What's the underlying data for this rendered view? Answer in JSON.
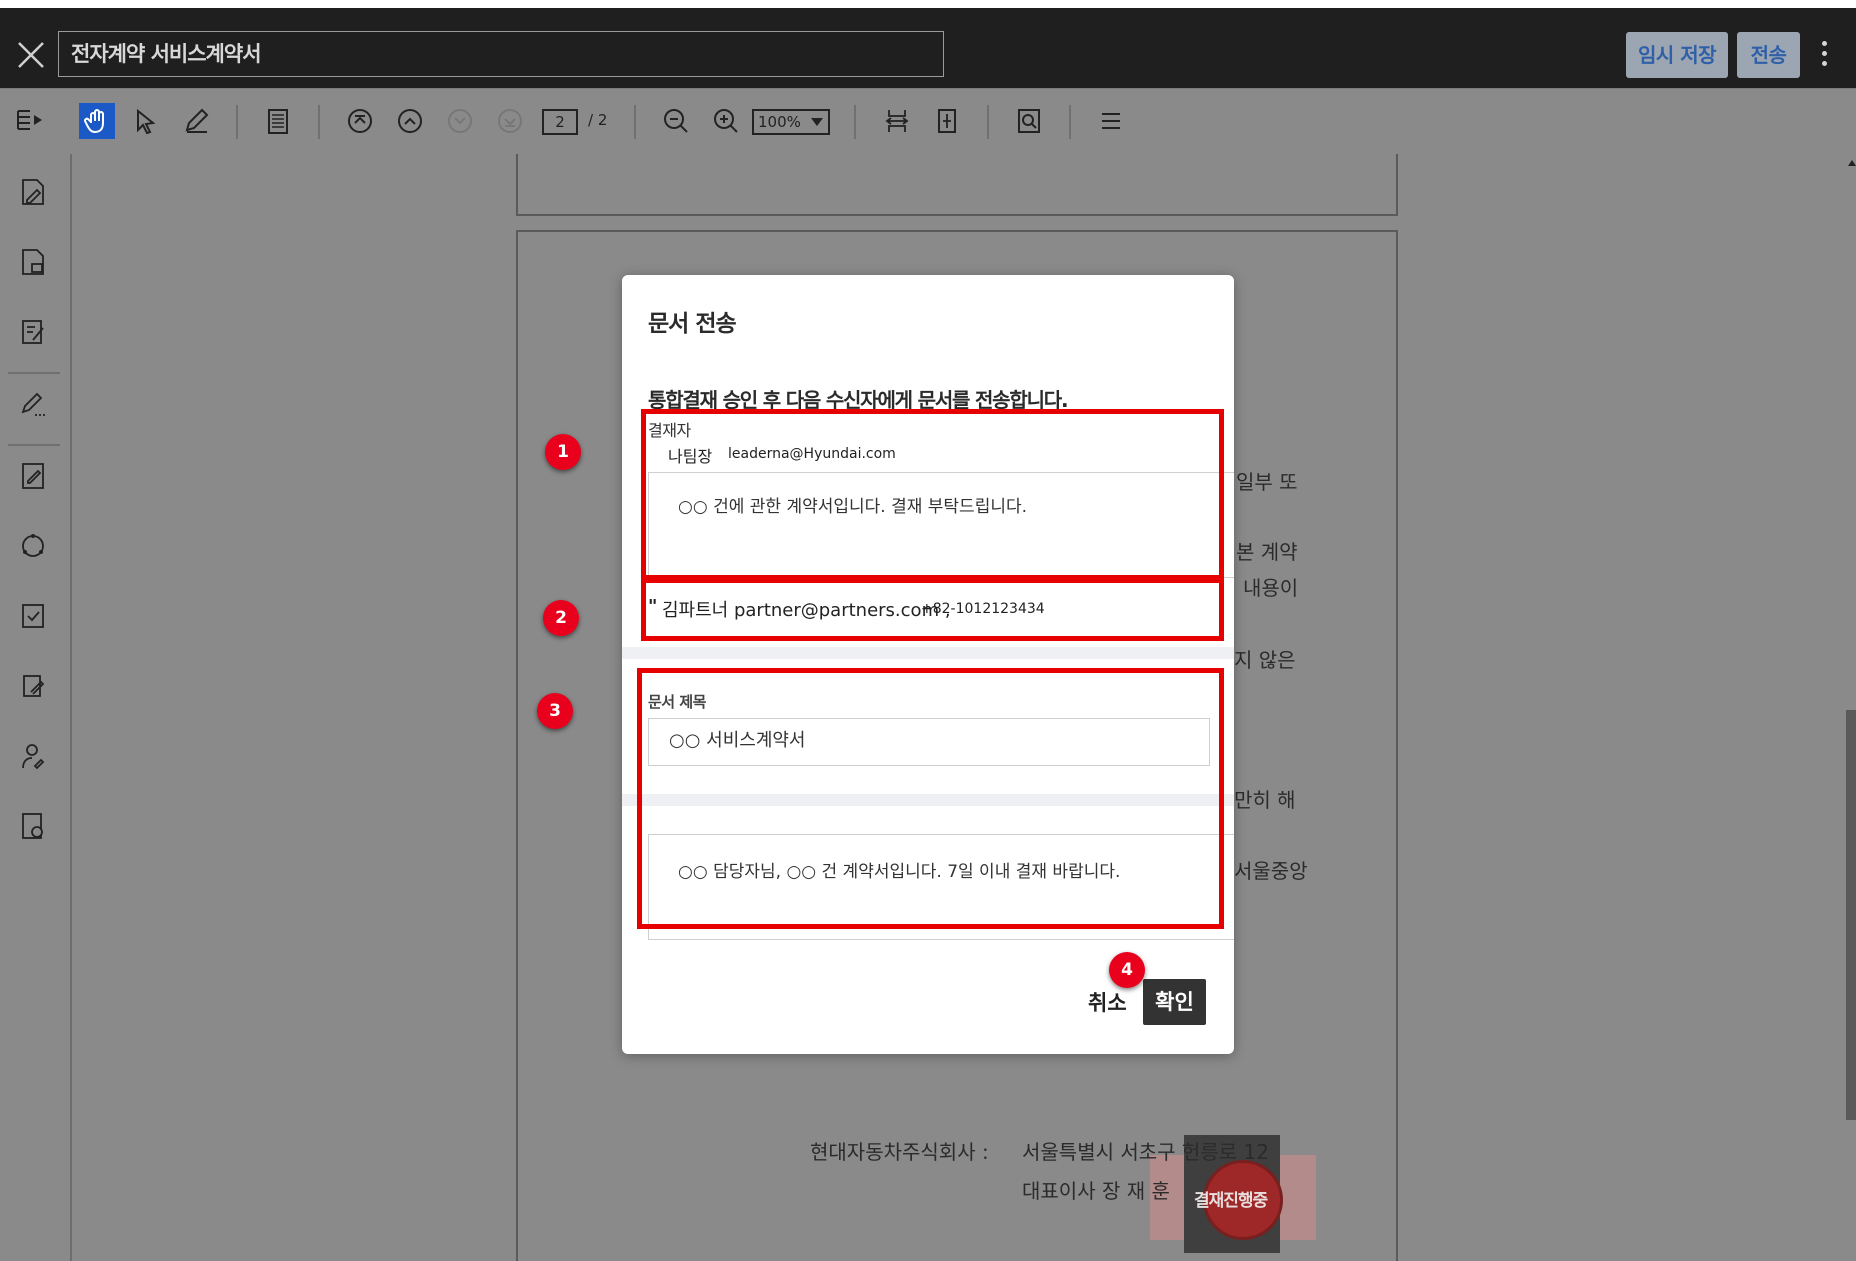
{
  "header": {
    "document_title": "전자계약 서비스계약서",
    "save_draft_label": "임시 저장",
    "send_label": "전송"
  },
  "toolbar": {
    "current_page": "2",
    "page_total": "/ 2",
    "zoom": "100%"
  },
  "document": {
    "lines": [
      "일부 또",
      "본 계약",
      "내용이",
      "지 않은",
      "만히 해",
      "서울중앙"
    ],
    "company": "현대자동차주식회사 :",
    "address": "서울특별시 서초구 헌릉로 12",
    "ceo": "대표이사  장 재 훈",
    "stamp_text": "결재진행중"
  },
  "dialog": {
    "title": "문서 전송",
    "description": "통합결재 승인 후 다음 수신자에게 문서를 전송합니다.",
    "approver_label": "결재자",
    "approver_name": "나팀장",
    "approver_email": "leaderna@Hyundai.com",
    "approver_message": "○○ 건에 관한 계약서입니다. 결재 부탁드립니다.",
    "recipient_mark": "\"",
    "recipient": "김파트너 partner@partners.com ,",
    "recipient_phone": "+82-1012123434",
    "doc_title_label": "문서 제목",
    "doc_title_value": "○○ 서비스계약서",
    "message": "○○ 담당자님, ○○ 건 계약서입니다. 7일 이내 결재 바랍니다.",
    "cancel_label": "취소",
    "confirm_label": "확인"
  },
  "annotations": {
    "badges": [
      "1",
      "2",
      "3",
      "4"
    ],
    "color": "#e60000"
  },
  "colors": {
    "header_bg": "#1f1f1f",
    "overlay": "#8a8a8a",
    "selected_tool": "#1b59c6",
    "confirm_bg": "#333333"
  }
}
